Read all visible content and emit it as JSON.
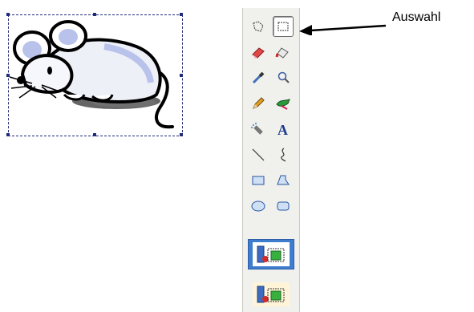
{
  "callout": {
    "label": "Auswahl"
  },
  "canvas": {
    "clipart": "mouse-clipart"
  },
  "toolbox": {
    "tools": [
      "free-form-select-icon",
      "rectangle-select-icon",
      "eraser-icon",
      "fill-bucket-icon",
      "pick-color-icon",
      "magnifier-icon",
      "pencil-icon",
      "brush-icon",
      "airbrush-icon",
      "text-icon",
      "line-icon",
      "curve-icon",
      "rectangle-icon",
      "polygon-icon",
      "ellipse-icon",
      "rounded-rectangle-icon"
    ],
    "selected_tool": "rectangle-select-icon",
    "transparency_options": [
      "opaque-selection-icon",
      "transparent-selection-icon"
    ],
    "selected_option": "opaque-selection-icon"
  },
  "colors": {
    "accent": "#3d7ccf",
    "selection_frame": "#1f2a7a"
  }
}
